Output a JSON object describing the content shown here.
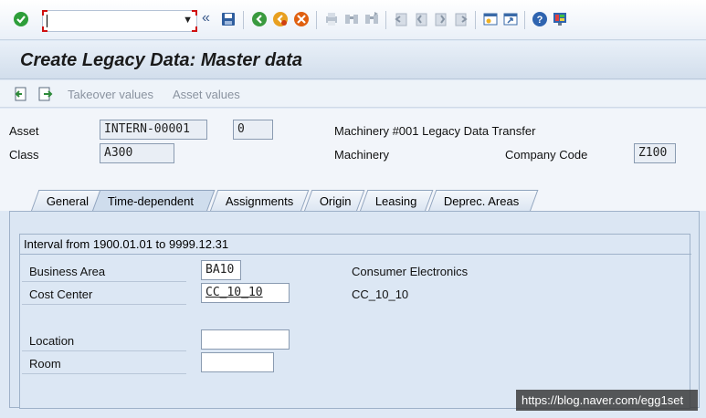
{
  "toolbar": {
    "command_value": "",
    "icons": [
      "enter-icon",
      "dropdown-icon",
      "history-icon",
      "save-icon",
      "back-icon",
      "exit-icon",
      "cancel-icon",
      "print-icon",
      "find-icon",
      "find-next-icon",
      "first-page-icon",
      "previous-page-icon",
      "next-page-icon",
      "last-page-icon",
      "create-session-icon",
      "shortcut-icon",
      "help-icon",
      "layout-icon"
    ]
  },
  "screen": {
    "title": "Create Legacy Data: Master data"
  },
  "appbar": {
    "takeover_label": "Takeover values",
    "asset_values_label": "Asset values"
  },
  "header": {
    "asset_label": "Asset",
    "asset_number": "INTERN-00001",
    "sub_number": "0",
    "asset_description": "Machinery #001 Legacy Data Transfer",
    "class_label": "Class",
    "class_value": "A300",
    "class_description": "Machinery",
    "company_code_label": "Company Code",
    "company_code_value": "Z100"
  },
  "tabs": [
    {
      "label": "General"
    },
    {
      "label": "Time-dependent"
    },
    {
      "label": "Assignments"
    },
    {
      "label": "Origin"
    },
    {
      "label": "Leasing"
    },
    {
      "label": "Deprec. Areas"
    }
  ],
  "active_tab": "Time-dependent",
  "interval": {
    "title": "Interval from 1900.01.01 to 9999.12.31",
    "business_area_label": "Business Area",
    "business_area_value": "BA10",
    "business_area_text": "Consumer Electronics",
    "cost_center_label": "Cost Center",
    "cost_center_value": "CC_10_10",
    "cost_center_text": "CC_10_10",
    "location_label": "Location",
    "location_value": "",
    "room_label": "Room",
    "room_value": ""
  },
  "watermark": "https://blog.naver.com/egg1set"
}
